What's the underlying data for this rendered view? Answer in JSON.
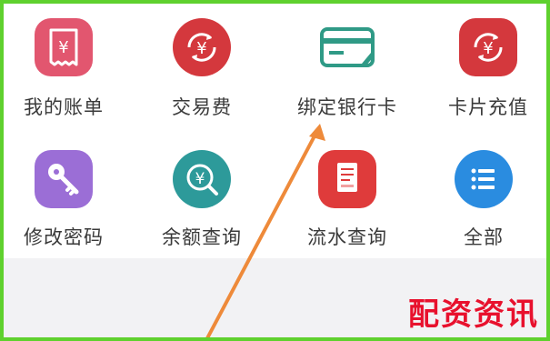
{
  "menu": {
    "row1": [
      {
        "label": "我的账单",
        "icon": "bill-receipt-icon",
        "color": "#e2566f"
      },
      {
        "label": "交易费",
        "icon": "yuan-exchange-icon",
        "color": "#d4383d"
      },
      {
        "label": "绑定银行卡",
        "icon": "bank-card-edit-icon",
        "color": "#2f9a86"
      },
      {
        "label": "卡片充值",
        "icon": "yuan-exchange-icon",
        "color": "#d4383d"
      }
    ],
    "row2": [
      {
        "label": "修改密码",
        "icon": "key-icon",
        "color": "#9b6ed6"
      },
      {
        "label": "余额查询",
        "icon": "yuan-search-icon",
        "color": "#2d9a9a"
      },
      {
        "label": "流水查询",
        "icon": "document-icon",
        "color": "#df3b3b"
      },
      {
        "label": "全部",
        "icon": "list-icon",
        "color": "#2a8ce0"
      }
    ]
  },
  "annotation": {
    "arrow_color": "#ee8a3a"
  },
  "watermark": {
    "text": "配资资讯",
    "color": "#e8112d"
  },
  "frame": {
    "border_color": "#5fd12e"
  }
}
